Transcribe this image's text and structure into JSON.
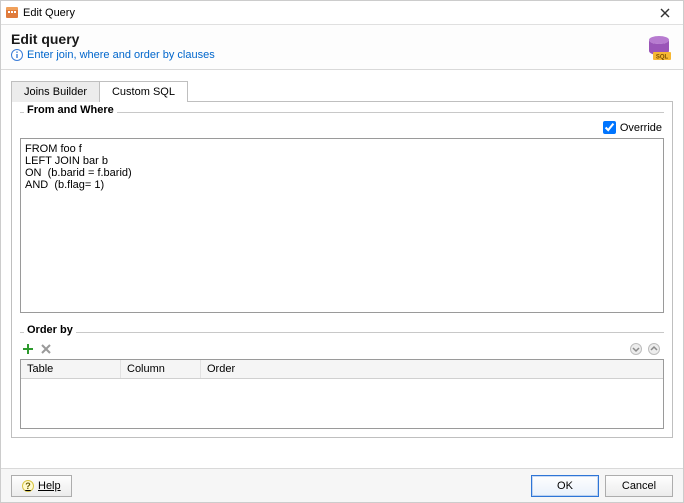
{
  "window": {
    "title": "Edit Query"
  },
  "header": {
    "heading": "Edit query",
    "hint": "Enter join, where and order by clauses"
  },
  "tabs": {
    "items": [
      {
        "label": "Joins Builder",
        "active": false
      },
      {
        "label": "Custom SQL",
        "active": true
      }
    ]
  },
  "fromWhere": {
    "legend": "From and Where",
    "overrideLabel": "Override",
    "overrideChecked": true,
    "sql": "FROM foo f\nLEFT JOIN bar b\nON  (b.barid = f.barid)\nAND  (b.flag= 1)"
  },
  "orderBy": {
    "legend": "Order by",
    "columns": {
      "table": "Table",
      "column": "Column",
      "order": "Order"
    },
    "rows": []
  },
  "buttons": {
    "help": "Help",
    "ok": "OK",
    "cancel": "Cancel"
  },
  "icons": {
    "add": "add-icon",
    "delete": "delete-icon",
    "moveDown": "arrow-down-icon",
    "moveUp": "arrow-up-icon",
    "info": "info-icon",
    "database": "database-sql-icon",
    "app": "app-icon",
    "close": "close-icon",
    "help": "help-icon"
  }
}
